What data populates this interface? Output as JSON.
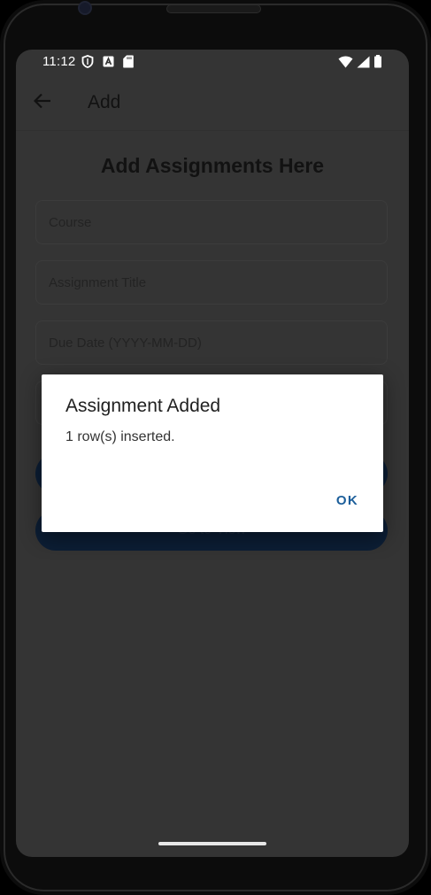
{
  "status_bar": {
    "time": "11:12",
    "left_icons": [
      "shield-icon",
      "font-a-icon",
      "sd-card-icon"
    ],
    "right_icons": [
      "wifi-icon",
      "cell-signal-icon",
      "battery-icon"
    ]
  },
  "app_bar": {
    "back_icon": "arrow-left-icon",
    "title": "Add"
  },
  "form": {
    "heading": "Add Assignments Here",
    "course_placeholder": "Course",
    "title_placeholder": "Assignment Title",
    "due_placeholder": "Due Date (YYYY-MM-DD)",
    "view_button_label": "Go to View"
  },
  "dialog": {
    "title": "Assignment Added",
    "message": "1 row(s) inserted.",
    "ok_label": "OK"
  },
  "colors": {
    "screen_bg": "#343434",
    "dialog_bg": "#ffffff",
    "dialog_action": "#1b5e9a",
    "button_bg": "#0c1e35"
  }
}
